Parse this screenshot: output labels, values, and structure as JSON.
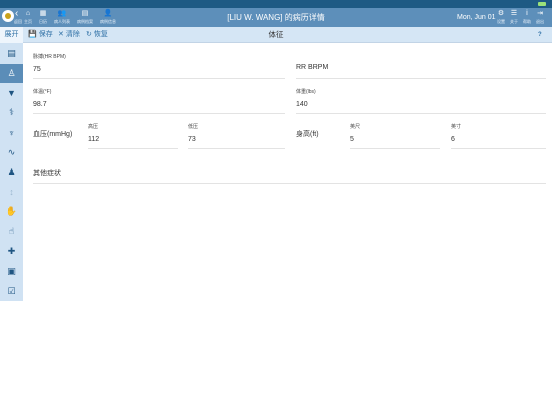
{
  "header": {
    "title": "[LIU W. WANG] 的病历详情",
    "back_label": "返回",
    "date": "Mon, Jun 01",
    "nav": [
      {
        "label": "主页",
        "icon": "home-icon",
        "glyph": "⌂"
      },
      {
        "label": "日历",
        "icon": "calendar-icon",
        "glyph": "▦"
      },
      {
        "label": "病人列表",
        "icon": "people-icon",
        "glyph": "👥"
      },
      {
        "label": "病例档案",
        "icon": "folder-icon",
        "glyph": "▤"
      },
      {
        "label": "病例信息",
        "icon": "person-icon",
        "glyph": "👤"
      }
    ],
    "right": [
      {
        "label": "设置",
        "icon": "gear-icon",
        "glyph": "⚙"
      },
      {
        "label": "关于",
        "icon": "list-icon",
        "glyph": "☰"
      },
      {
        "label": "帮助",
        "icon": "info-icon",
        "glyph": "ⅰ"
      },
      {
        "label": "退出",
        "icon": "logout-icon",
        "glyph": "⇥"
      }
    ]
  },
  "toolbar": {
    "expand_label": "展开",
    "save_label": "保存",
    "clear_label": "清除",
    "restore_label": "恢复",
    "section_title": "体征",
    "help_label": "?"
  },
  "sidebar": {
    "items": [
      {
        "icon": "notebook-icon",
        "glyph": "▤"
      },
      {
        "icon": "body-icon",
        "glyph": "♙",
        "active": true
      },
      {
        "icon": "pill-icon",
        "glyph": "▼"
      },
      {
        "icon": "stethoscope-icon",
        "glyph": "⚕"
      },
      {
        "icon": "tooth-icon",
        "glyph": "♆"
      },
      {
        "icon": "pulse-icon",
        "glyph": "∿"
      },
      {
        "icon": "person-icon",
        "glyph": "♟"
      },
      {
        "icon": "syringe-icon",
        "glyph": "↕",
        "dim": true
      },
      {
        "icon": "hand-icon",
        "glyph": "✋",
        "dim": true
      },
      {
        "icon": "finger-icon",
        "glyph": "☝"
      },
      {
        "icon": "add-icon",
        "glyph": "✚"
      },
      {
        "icon": "scan-icon",
        "glyph": "▣"
      },
      {
        "icon": "checklist-icon",
        "glyph": "☑"
      }
    ]
  },
  "vitals": {
    "pulse": {
      "label": "脉搏(HR BPM)",
      "value": "75"
    },
    "rr": {
      "label": "RR BRPM"
    },
    "temperature": {
      "label": "体温(°F)",
      "value": "98.7"
    },
    "weight": {
      "label": "体重(lbs)",
      "value": "140"
    },
    "blood_pressure": {
      "label": "血压(mmHg)",
      "systolic_label": "高压",
      "systolic_value": "112",
      "diastolic_label": "低压",
      "diastolic_value": "73"
    },
    "height": {
      "label": "身高(ft)",
      "feet_label": "英尺",
      "feet_value": "5",
      "inches_label": "英寸",
      "inches_value": "6"
    },
    "other_symptoms_label": "其他症状"
  }
}
